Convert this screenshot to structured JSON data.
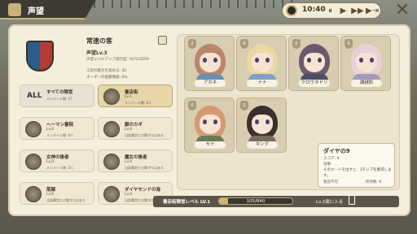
{
  "header": {
    "title": "声望"
  },
  "clock": {
    "time": "10:40",
    "pause": "⏸",
    "play": "▶",
    "ff": "▶▶",
    "skip": "▶⇥"
  },
  "close": "✕",
  "reputation": {
    "crest_title": "常連の客",
    "level": "声望Lv.3",
    "progress": "声望レベルアップ進行度: 1672/3500",
    "desc1": "工房の魅力を高める: 30",
    "desc2": "オーダーの金額増加: 6%"
  },
  "factions": [
    {
      "key": "all",
      "label": "ALL",
      "name": "すべての陣営",
      "count": "メンバー人数: 17"
    },
    {
      "key": "library",
      "name": "書店街",
      "level": "Lv.1",
      "count": "メンバー人数: 6人",
      "selected": true
    },
    {
      "key": "hermann",
      "name": "ヘーマン書院",
      "level": "Lv.0",
      "count": "メンバー人数: 6人"
    },
    {
      "key": "key",
      "name": "銀のカギ",
      "level": "Lv.0",
      "count": "当該陣営との繋がりはあり"
    },
    {
      "key": "goddess",
      "name": "女神の後者",
      "level": "Lv.0",
      "count": "メンバー人数: 5人"
    },
    {
      "key": "witch",
      "name": "魔女の後者",
      "level": "Lv.0",
      "count": "当該陣営との繋がりはあり"
    },
    {
      "key": "thorn",
      "name": "荊棘",
      "level": "Lv.0",
      "count": "当該陣営との繋がりはあり"
    },
    {
      "key": "diamond",
      "name": "ダイヤモンドの海",
      "level": "Lv.0",
      "count": "当該陣営との繋がりはあり"
    }
  ],
  "characters": [
    {
      "name": "アカネ",
      "badge": "2",
      "hair": "#b9866a",
      "dress": "#6a8fb3"
    },
    {
      "name": "ナナ",
      "badge": "6",
      "hair": "#e9d8a3",
      "dress": "#7fa0c8"
    },
    {
      "name": "クロウタドリ",
      "badge": "0",
      "hair": "#6b5a6e",
      "dress": "#4c4f6a"
    },
    {
      "name": "湖越鈴",
      "badge": "0",
      "hair": "#e8cfd8",
      "dress": "#a49bb8"
    },
    {
      "name": "モナ",
      "badge": "0",
      "hair": "#d59a72",
      "dress": "#6b7b5a"
    },
    {
      "name": "キング",
      "badge": "1",
      "hair": "#3a2f2c",
      "dress": "#7a6b5a"
    }
  ],
  "rolecard": {
    "title": "ダイヤの9",
    "score": "スコア: 9",
    "effect_label": "効果:",
    "effect": "そのカードを出すと、1チップを獲得します。",
    "owner": "製造不可",
    "skip": "所持数: 6"
  },
  "bottom": {
    "label": "書店街陣営レベル LV.1",
    "progress": "105/840",
    "progress_fraction": 0.125,
    "next": "Lv.2達に入る"
  }
}
